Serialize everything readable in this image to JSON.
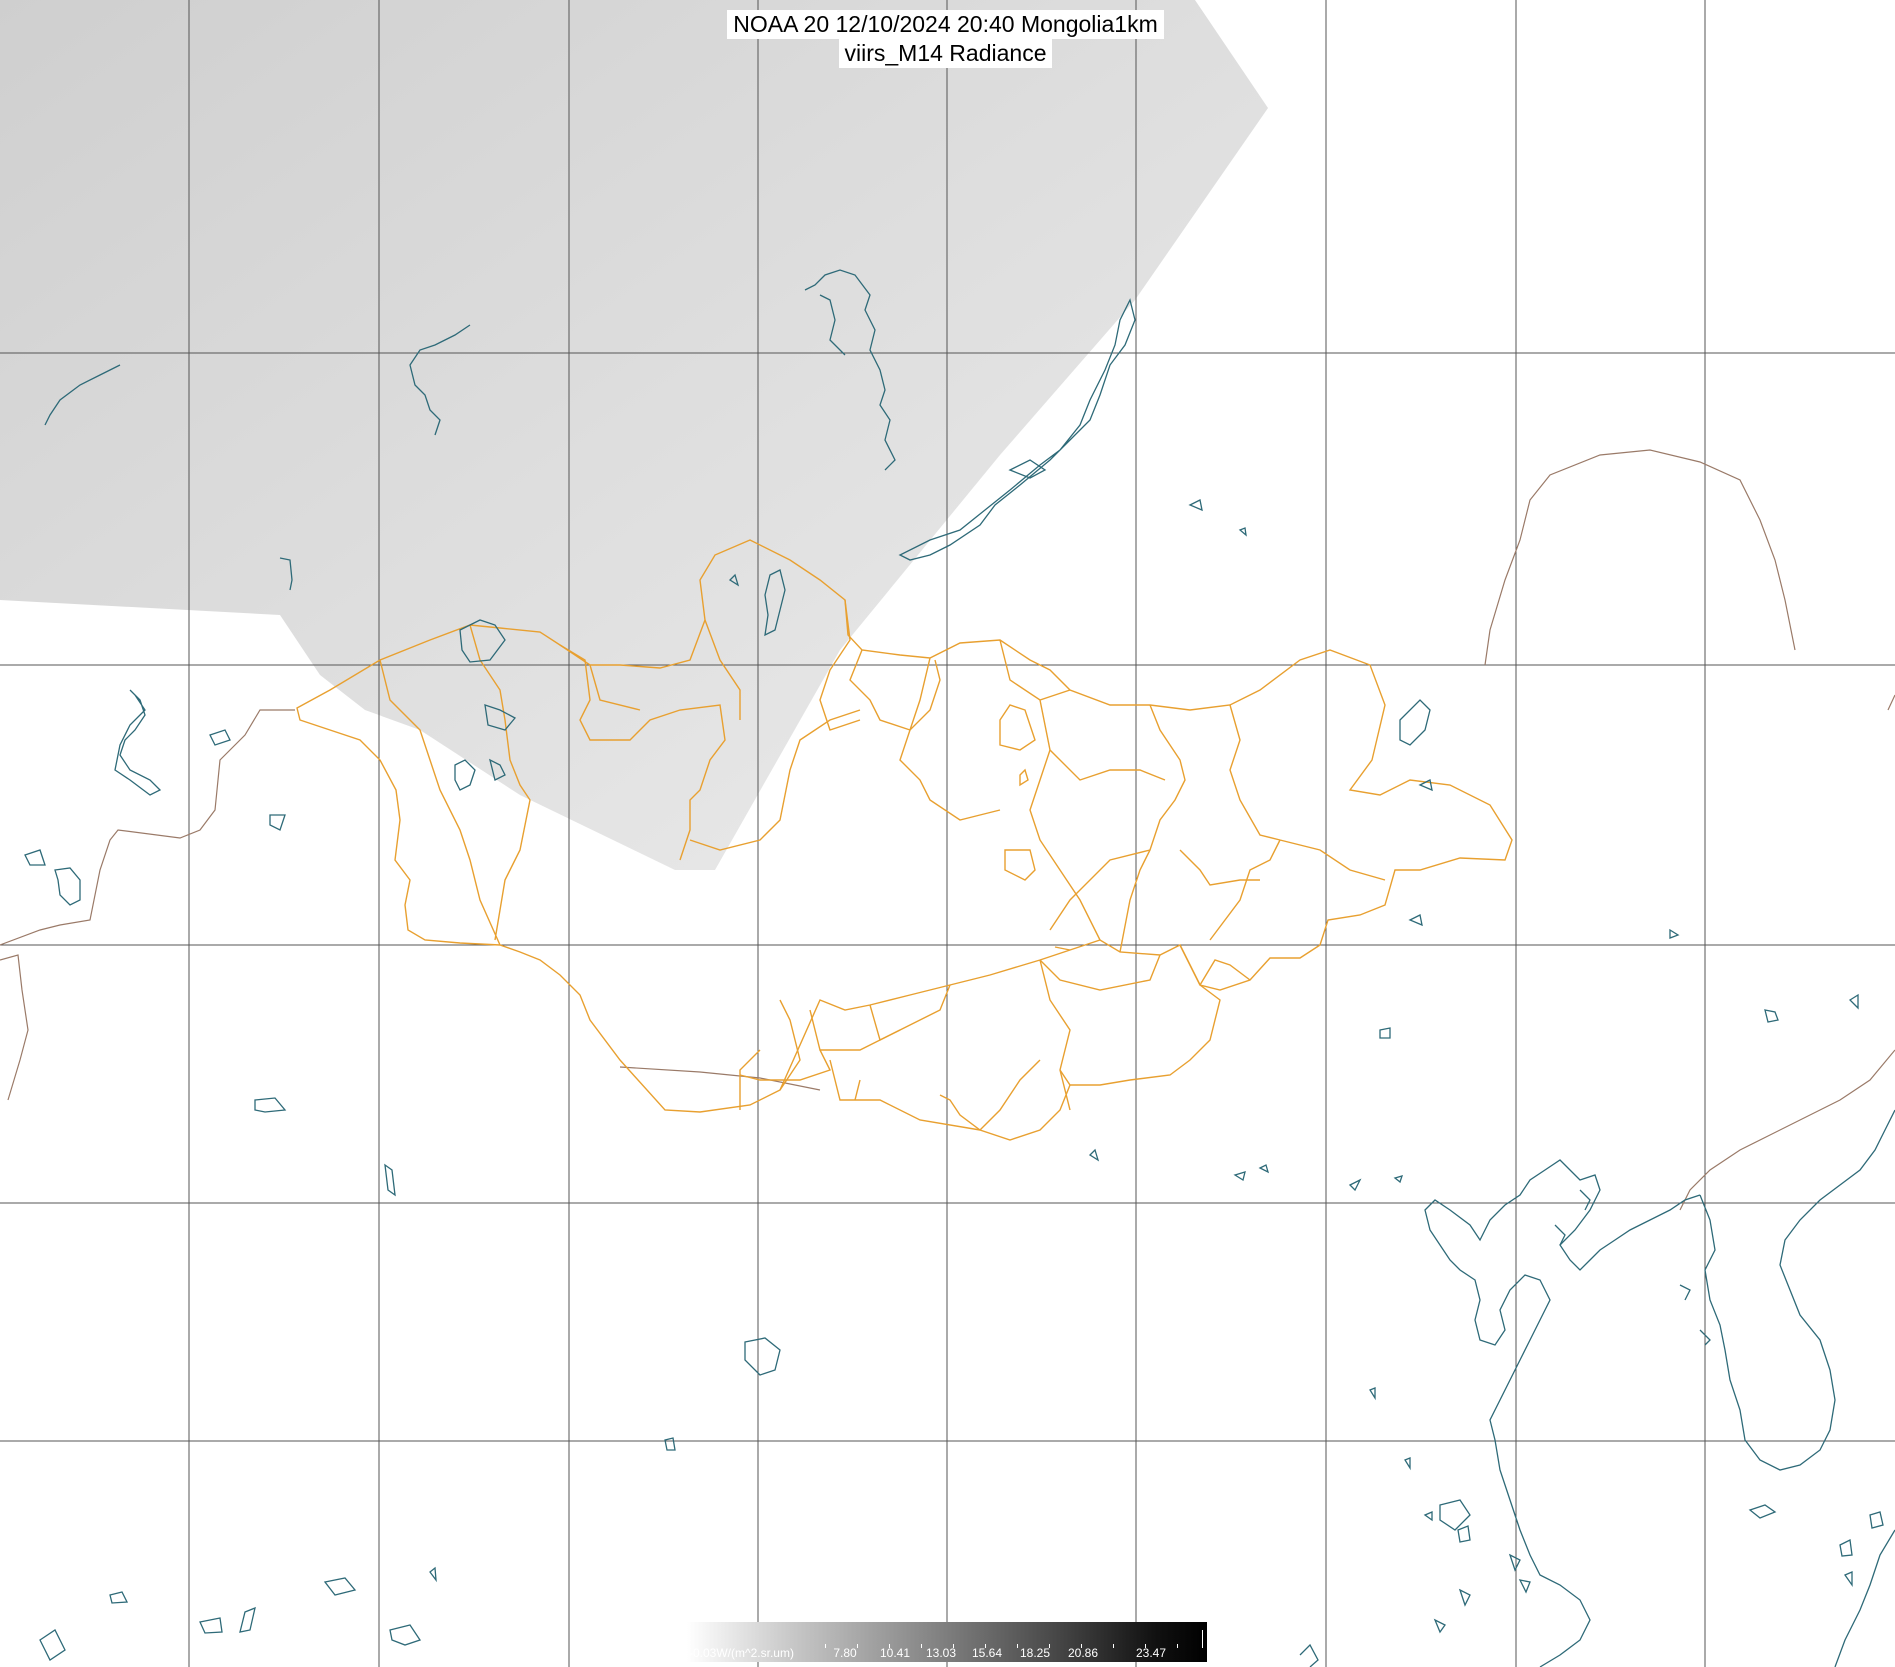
{
  "title": {
    "line1": "NOAA 20 12/10/2024 20:40 Mongolia1km",
    "line2": "viirs_M14 Radiance"
  },
  "colorbar": {
    "labels": [
      "-0.03W/(m^2.sr.um)",
      "7.80",
      "10.41",
      "13.03",
      "15.64",
      "18.25",
      "20.86",
      "23.47"
    ]
  },
  "colors": {
    "grid": "#555555",
    "province_borders": "#e8a030",
    "country_borders": "#9a7a68",
    "water": "#2e6a78",
    "satellite_swath": "#dcdcdc"
  }
}
